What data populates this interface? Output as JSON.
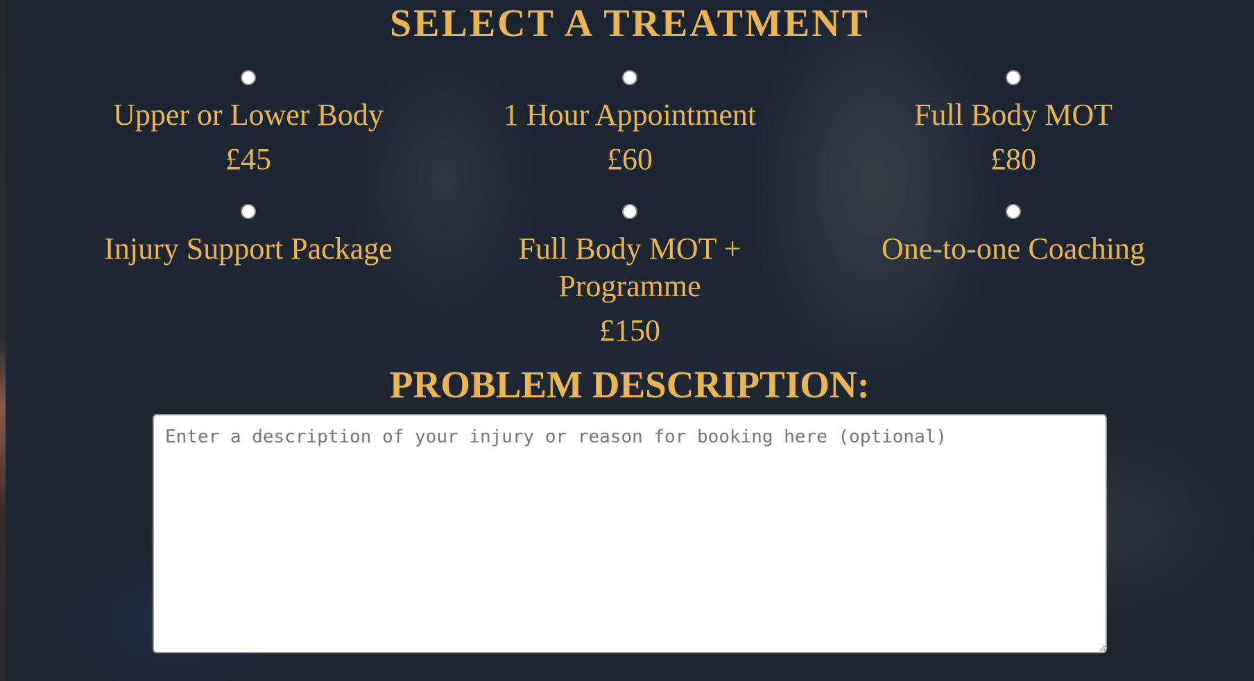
{
  "page": {
    "title": "SELECT A TREATMENT"
  },
  "treatments": [
    {
      "name": "Upper or Lower Body",
      "price": "£45"
    },
    {
      "name": "1 Hour Appointment",
      "price": "£60"
    },
    {
      "name": "Full Body MOT",
      "price": "£80"
    },
    {
      "name": "Injury Support Package",
      "price": ""
    },
    {
      "name": "Full Body MOT + Programme",
      "price": "£150"
    },
    {
      "name": "One-to-one Coaching",
      "price": ""
    }
  ],
  "description": {
    "label": "PROBLEM DESCRIPTION:",
    "placeholder": "Enter a description of your injury or reason for booking here (optional)",
    "value": ""
  },
  "colors": {
    "accent": "#ecb553",
    "background": "#1d2633"
  }
}
